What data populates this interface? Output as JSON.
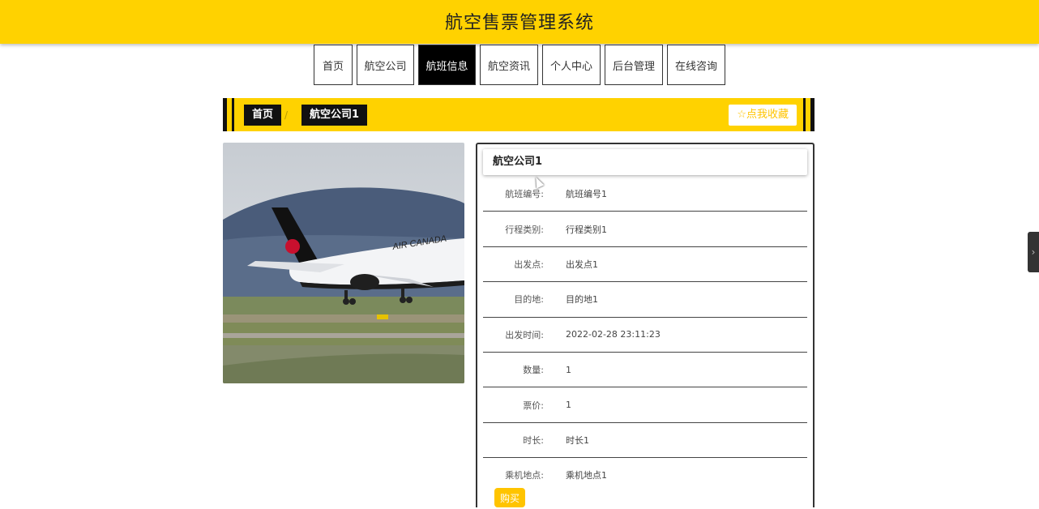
{
  "header": {
    "title": "航空售票管理系统"
  },
  "nav": [
    {
      "label": "首页",
      "active": false
    },
    {
      "label": "航空公司",
      "active": false
    },
    {
      "label": "航班信息",
      "active": true
    },
    {
      "label": "航空资讯",
      "active": false
    },
    {
      "label": "个人中心",
      "active": false
    },
    {
      "label": "后台管理",
      "active": false
    },
    {
      "label": "在线咨询",
      "active": false
    }
  ],
  "breadcrumb": {
    "home": "首页",
    "separator": "/",
    "current": "航空公司1"
  },
  "favorite": {
    "icon": "star-icon",
    "label": "☆点我收藏"
  },
  "detail": {
    "title": "航空公司1",
    "fields": [
      {
        "label": "航班编号:",
        "value": "航班编号1"
      },
      {
        "label": "行程类别:",
        "value": "行程类别1"
      },
      {
        "label": "出发点:",
        "value": "出发点1"
      },
      {
        "label": "目的地:",
        "value": "目的地1"
      },
      {
        "label": "出发时间:",
        "value": "2022-02-28 23:11:23"
      },
      {
        "label": "数量:",
        "value": "1"
      },
      {
        "label": "票价:",
        "value": "1"
      },
      {
        "label": "时长:",
        "value": "时长1"
      },
      {
        "label": "乘机地点:",
        "value": "乘机地点1"
      }
    ],
    "submit_label": "购买"
  },
  "side_toggle": {
    "icon": "chevron-right-icon",
    "glyph": "›"
  },
  "colors": {
    "accent": "#ffd200",
    "dark": "#111111",
    "button": "#ffc400"
  }
}
